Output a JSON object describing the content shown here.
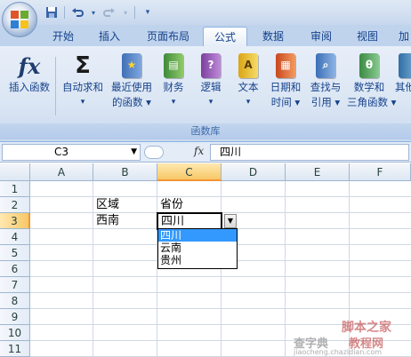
{
  "qat": {
    "save": "save-icon",
    "undo": "undo-icon",
    "redo": "redo-icon",
    "more": "▾"
  },
  "tabs": [
    "开始",
    "插入",
    "页面布局",
    "公式",
    "数据",
    "审阅",
    "视图",
    "加"
  ],
  "active_tab": "公式",
  "ribbon": {
    "buttons": [
      {
        "line1": "插入函数",
        "line2": ""
      },
      {
        "line1": "自动求和",
        "line2": "▾"
      },
      {
        "line1": "最近使用",
        "line2": "的函数 ▾"
      },
      {
        "line1": "财务",
        "line2": "▾"
      },
      {
        "line1": "逻辑",
        "line2": "▾"
      },
      {
        "line1": "文本",
        "line2": "▾"
      },
      {
        "line1": "日期和",
        "line2": "时间 ▾"
      },
      {
        "line1": "查找与",
        "line2": "引用 ▾"
      },
      {
        "line1": "数学和",
        "line2": "三角函数 ▾"
      },
      {
        "line1": "其他",
        "line2": ""
      }
    ],
    "group_label": "函数库"
  },
  "formula_bar": {
    "name_box": "C3",
    "fx": "fx",
    "content": "四川"
  },
  "grid": {
    "columns": [
      "A",
      "B",
      "C",
      "D",
      "E",
      "F"
    ],
    "rows": [
      "1",
      "2",
      "3",
      "4",
      "5",
      "6",
      "7",
      "8",
      "9",
      "10",
      "11"
    ],
    "cells": {
      "B2": "区域",
      "C2": "省份",
      "B3": "西南",
      "C3": "四川"
    }
  },
  "dropdown": {
    "options": [
      "四川",
      "云南",
      "贵州"
    ],
    "selected": "四川"
  },
  "watermark": {
    "line1": "脚本之家",
    "line2": "jiaocheng.chazidian.com",
    "prefix": "查字典",
    "suffix": "教程网"
  }
}
